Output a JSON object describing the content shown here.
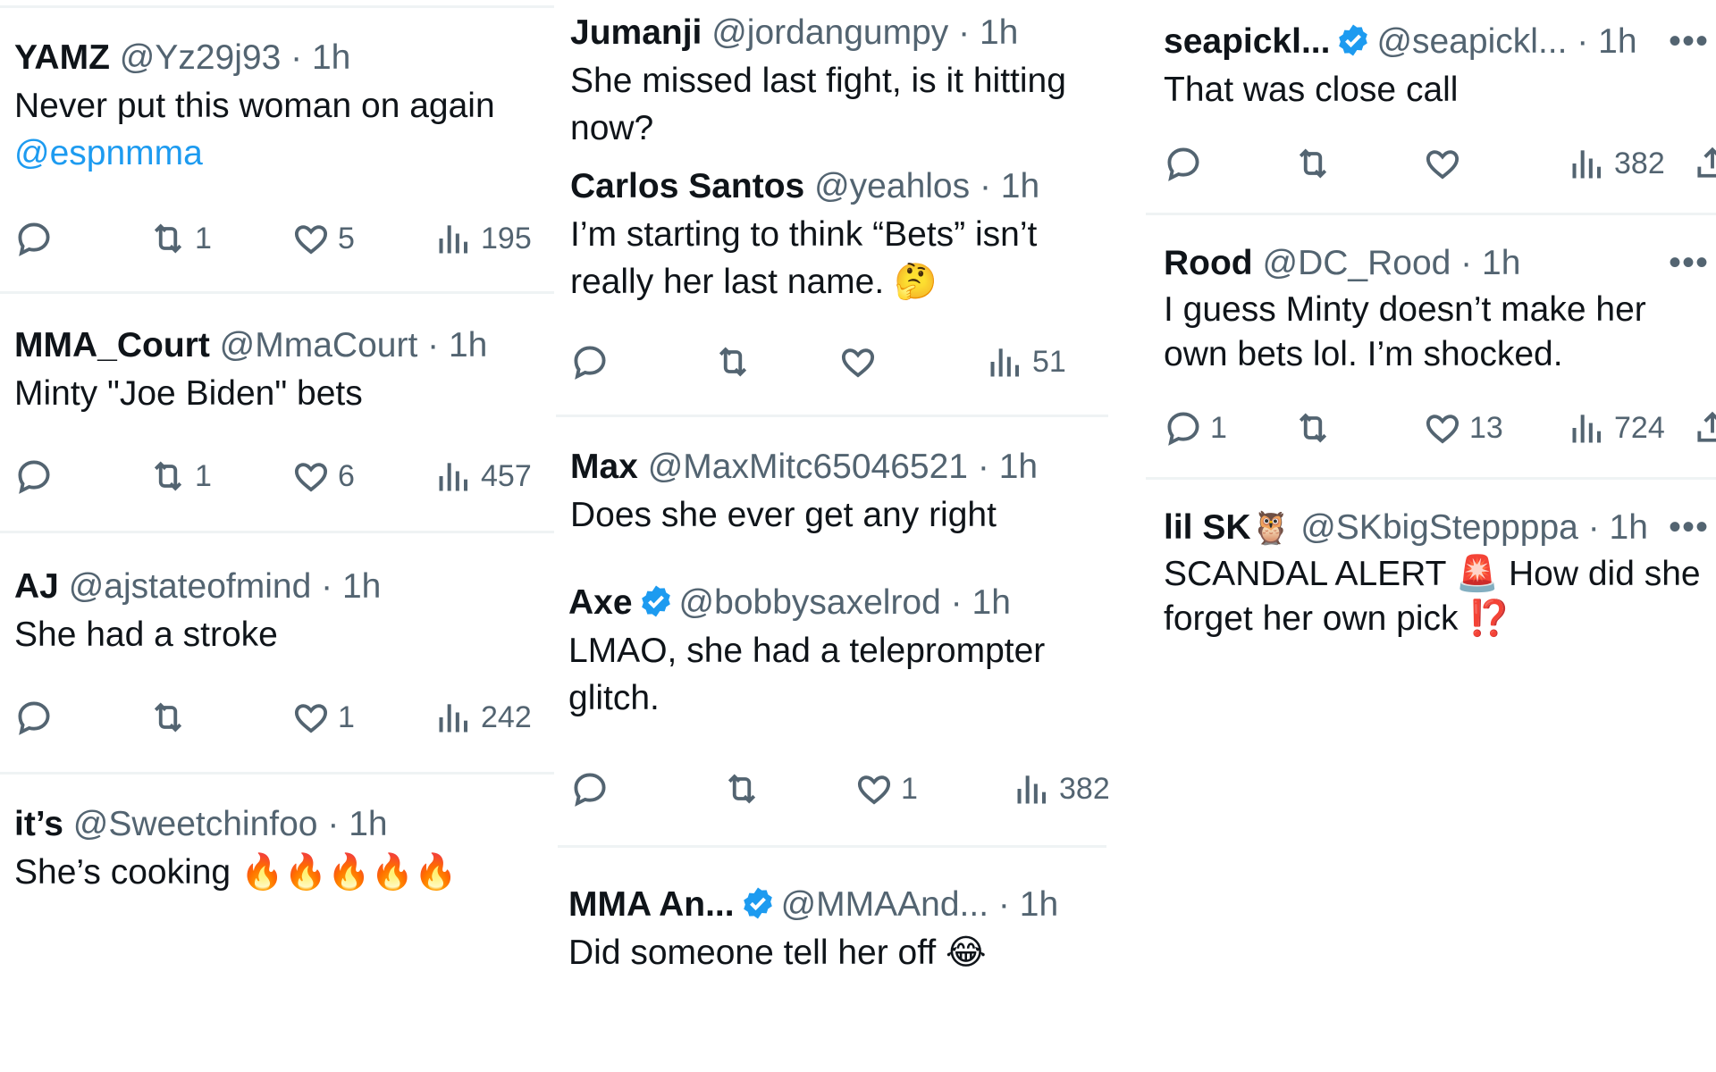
{
  "columns": [
    [
      {
        "name": "YAMZ",
        "handle": "@Yz29j93",
        "dot": "·",
        "time": "1h",
        "body": "Never put this woman on again ",
        "mention": "@espnmma",
        "replies": "",
        "retweets": "1",
        "likes": "5",
        "views": "195"
      },
      {
        "name": "MMA_Court",
        "handle": "@MmaCourt",
        "dot": "·",
        "time": "1h",
        "body": "Minty \"Joe Biden\" bets",
        "replies": "",
        "retweets": "1",
        "likes": "6",
        "views": "457"
      },
      {
        "name": "AJ",
        "handle": "@ajstateofmind",
        "dot": "·",
        "time": "1h",
        "body": "She had a stroke",
        "replies": "",
        "retweets": "",
        "likes": "1",
        "views": "242"
      },
      {
        "name": "it’s",
        "handle": "@Sweetchinfoo",
        "dot": "·",
        "time": "1h",
        "body": "She’s cooking 🔥🔥🔥🔥🔥"
      }
    ],
    [
      {
        "name": "Jumanji",
        "handle": "@jordangumpy",
        "dot": "·",
        "time": "1h",
        "body": "She missed last fight, is it hitting now?"
      },
      {
        "name": "Carlos Santos",
        "handle": "@yeahlos",
        "dot": "·",
        "time": "1h",
        "body": "I’m starting to think “Bets” isn’t really her last name. 🤔",
        "replies": "",
        "retweets": "",
        "likes": "",
        "views": "51"
      },
      {
        "name": "Max",
        "handle": "@MaxMitc65046521",
        "dot": "·",
        "time": "1h",
        "body": "Does she ever get any right"
      },
      {
        "name": "Axe",
        "verified": true,
        "handle": "@bobbysaxelrod",
        "dot": "·",
        "time": "1h",
        "body": "LMAO, she had a teleprompter glitch.",
        "replies": "",
        "retweets": "",
        "likes": "1",
        "views": "382"
      },
      {
        "name": "MMA An...",
        "verified": true,
        "handle": "@MMAAnd...",
        "dot": "·",
        "time": "1h",
        "body": "Did someone tell her off 😂"
      }
    ],
    [
      {
        "name": "seapickl...",
        "verified": true,
        "handle": "@seapickl...",
        "dot": "·",
        "time": "1h",
        "more": "•••",
        "body": "That was close call",
        "replies": "",
        "retweets": "",
        "likes": "",
        "views": "382"
      },
      {
        "name": "Rood",
        "handle": "@DC_Rood",
        "dot": "·",
        "time": "1h",
        "more": "•••",
        "body": "I guess Minty doesn’t make her own bets lol. I’m shocked.",
        "replies": "1",
        "retweets": "",
        "likes": "13",
        "views": "724"
      },
      {
        "name": "lil SK",
        "name_emoji": "🦉",
        "handle": "@SKbigSteppppa",
        "dot": "·",
        "time": "1h",
        "more": "•••",
        "body": "SCANDAL ALERT 🚨 How did she forget her own pick ⁉️"
      }
    ]
  ],
  "colors": {
    "text": "#0f1419",
    "secondary": "#536471",
    "link": "#1d9bf0",
    "verified": "#1d9bf0",
    "divider": "#eff3f4"
  },
  "icons": {
    "reply": "reply-icon",
    "retweet": "retweet-icon",
    "like": "heart-icon",
    "views": "views-icon",
    "share": "share-icon",
    "verified": "verified-badge-icon"
  }
}
